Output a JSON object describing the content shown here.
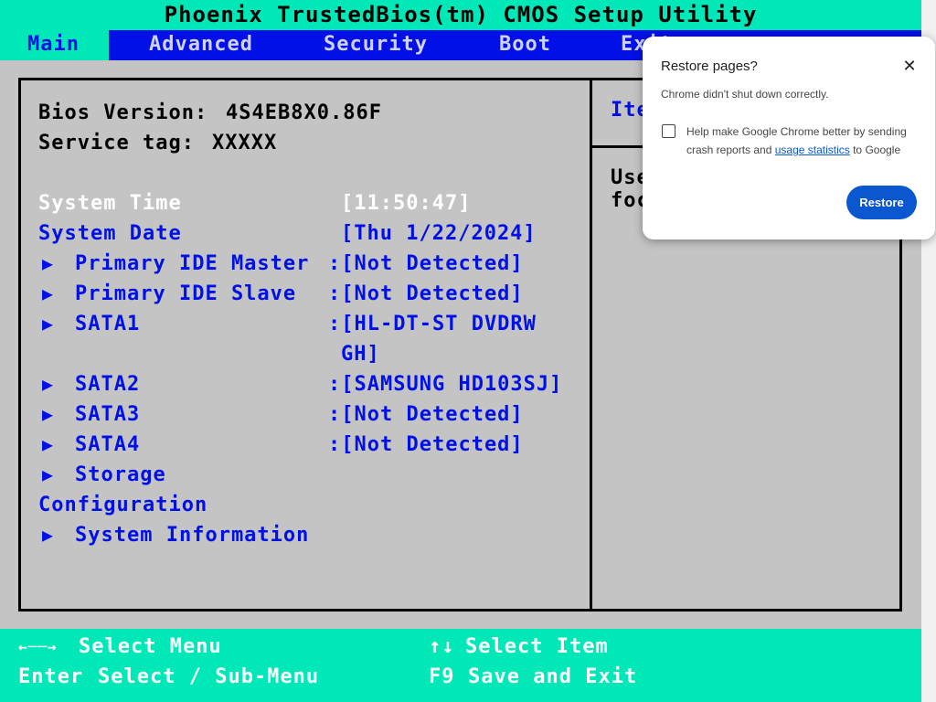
{
  "title": "Phoenix TrustedBios(tm) CMOS Setup Utility",
  "tabs": [
    {
      "label": "Main"
    },
    {
      "label": "Advanced"
    },
    {
      "label": "Security"
    },
    {
      "label": "Boot"
    },
    {
      "label": "Exit"
    }
  ],
  "main": {
    "bios_version_label": "Bios Version:",
    "bios_version_value": "4S4EB8X0.86F",
    "service_tag_label": "Service tag:",
    "service_tag_value": "XXXXX",
    "rows": [
      {
        "label": "System Time",
        "value": "[11:50:47]"
      },
      {
        "label": "System Date",
        "value": "[Thu 1/22/2024]"
      },
      {
        "label": "Primary IDE Master",
        "value": ":[Not Detected]"
      },
      {
        "label": "Primary IDE Slave",
        "value": ":[Not Detected]"
      },
      {
        "label": "SATA1",
        "value": ":[HL-DT-ST DVDRW",
        "value_cont": "GH]"
      },
      {
        "label": "SATA2",
        "value": ":[SAMSUNG HD103SJ]"
      },
      {
        "label": "SATA3",
        "value": ":[Not Detected]"
      },
      {
        "label": "SATA4",
        "value": ":[Not Detected]"
      },
      {
        "label": "Storage",
        "label_cont": "Configuration"
      },
      {
        "label": "System Information"
      }
    ]
  },
  "help": {
    "title": "Ite",
    "line1": "Use",
    "line2": "foc"
  },
  "footer": {
    "select_menu_keys": "←──→",
    "select_menu": "Select Menu",
    "enter_key": "Enter",
    "select_submenu": "Select / Sub-Menu",
    "select_item_keys": "↑↓",
    "select_item": "Select Item",
    "f9_key": "F9",
    "save_exit": "Save and Exit"
  },
  "popup": {
    "title": "Restore pages?",
    "message": "Chrome didn't shut down correctly.",
    "help_prefix": "Help make Google Chrome better by sending crash reports and ",
    "help_link": "usage statistics",
    "help_suffix": " to Google",
    "restore_label": "Restore",
    "close_icon": "close-icon"
  },
  "colors": {
    "bios_bg": "#c4c4c4",
    "title_bg": "#00e8b8",
    "menu_bg": "#0010e6",
    "highlight_text": "#ffffff",
    "item_text": "#0010e6",
    "chrome_blue": "#0b57d0"
  }
}
